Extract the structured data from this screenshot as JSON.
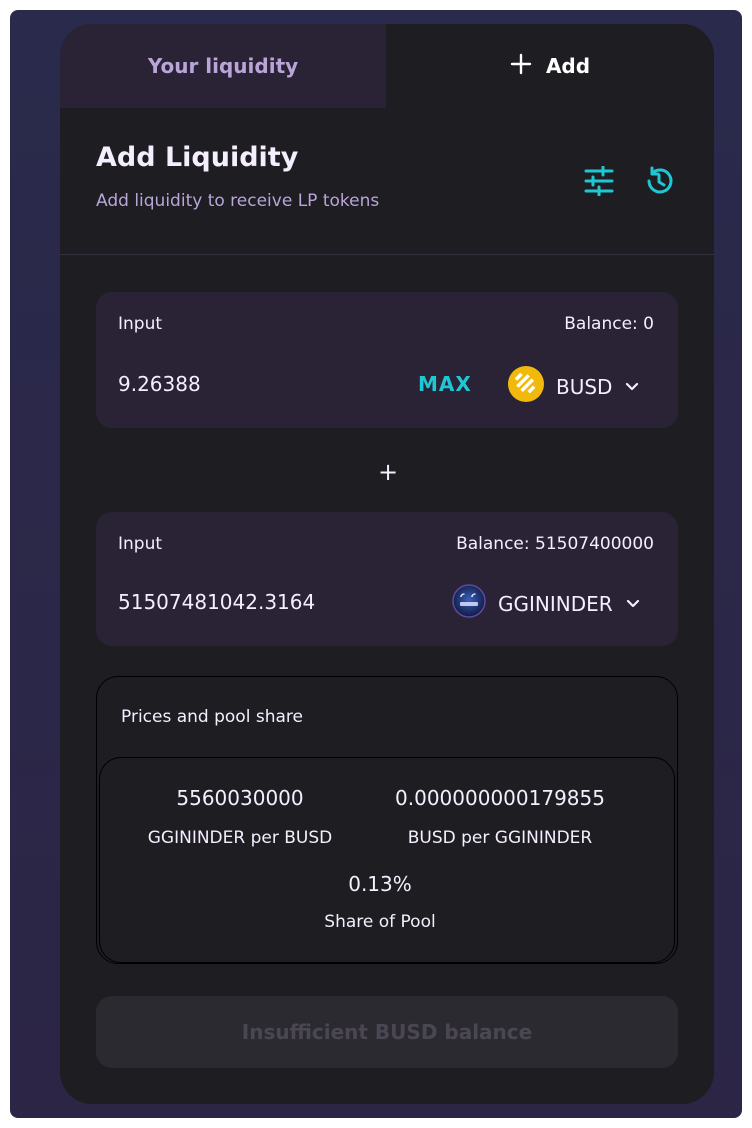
{
  "tabs": {
    "your_liquidity": "Your liquidity",
    "add": "Add"
  },
  "header": {
    "title": "Add Liquidity",
    "subtitle": "Add liquidity to receive LP tokens"
  },
  "icons": {
    "settings": "sliders-icon",
    "history": "history-icon",
    "plus": "plus-icon",
    "chevron": "chevron-down-icon"
  },
  "input_a": {
    "label": "Input",
    "balance": "Balance: 0",
    "value": "9.26388",
    "max_label": "MAX",
    "token": "BUSD"
  },
  "separator": "+",
  "input_b": {
    "label": "Input",
    "balance": "Balance: 51507400000",
    "value": "51507481042.3164",
    "token": "GGININDER"
  },
  "prices": {
    "title": "Prices and pool share",
    "rate_a_value": "5560030000",
    "rate_a_label": "GGININDER per BUSD",
    "rate_b_value": "0.000000000179855",
    "rate_b_label": "BUSD per GGININDER",
    "share_value": "0.13%",
    "share_label": "Share of Pool"
  },
  "submit": {
    "label": "Insufficient BUSD balance"
  },
  "colors": {
    "accent": "#1fc7d4",
    "card": "#1e1d22",
    "input_bg": "#2a2335",
    "secondary_text": "#b9a5d8",
    "busd": "#f0b90b"
  }
}
